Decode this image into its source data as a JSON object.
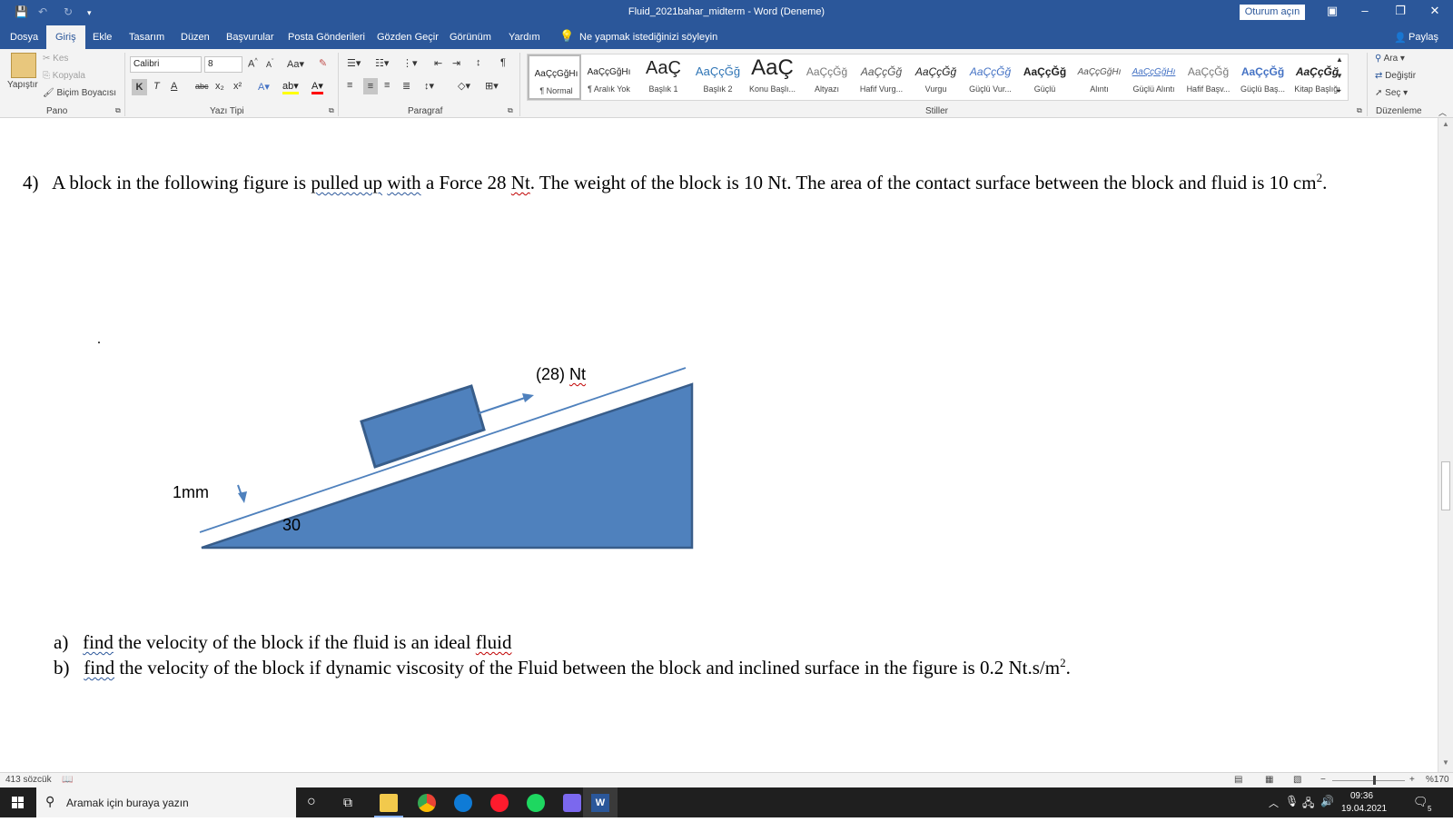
{
  "window": {
    "title": "Fluid_2021bahar_midterm  -  Word (Deneme)",
    "signin_label": "Oturum açın"
  },
  "tabs": [
    "Dosya",
    "Giriş",
    "Ekle",
    "Tasarım",
    "Düzen",
    "Başvurular",
    "Posta Gönderileri",
    "Gözden Geçir",
    "Görünüm",
    "Yardım"
  ],
  "active_tab": "Giriş",
  "tell_me": "Ne yapmak istediğinizi söyleyin",
  "share_label": "Paylaş",
  "ribbon": {
    "clipboard": {
      "paste": "Yapıştır",
      "cut": "Kes",
      "copy": "Kopyala",
      "format_painter": "Biçim Boyacısı",
      "label": "Pano"
    },
    "font": {
      "name": "Calibri",
      "size": "8",
      "bold": "K",
      "italic": "T",
      "underline": "A",
      "strike": "abc",
      "subscript": "x₂",
      "superscript": "x²",
      "label": "Yazı Tipi"
    },
    "paragraph": {
      "label": "Paragraf"
    },
    "styles": {
      "label": "Stiller",
      "items": [
        {
          "preview": "AaÇçĞğHı",
          "name": "¶ Normal"
        },
        {
          "preview": "AaÇçĞğHı",
          "name": "¶ Aralık Yok"
        },
        {
          "preview": "AaÇ",
          "name": "Başlık 1"
        },
        {
          "preview": "AaÇçĞğ",
          "name": "Başlık 2"
        },
        {
          "preview": "AaÇ",
          "name": "Konu Başlı..."
        },
        {
          "preview": "AaÇçĞğ",
          "name": "Altyazı"
        },
        {
          "preview": "AaÇçĞğ",
          "name": "Hafif Vurg..."
        },
        {
          "preview": "AaÇçĞğ",
          "name": "Vurgu"
        },
        {
          "preview": "AaÇçĞğ",
          "name": "Güçlü Vur..."
        },
        {
          "preview": "AaÇçĞğ",
          "name": "Güçlü"
        },
        {
          "preview": "AaÇçĞğHı",
          "name": "Alıntı"
        },
        {
          "preview": "AaÇçĞğHı",
          "name": "Güçlü Alıntı"
        },
        {
          "preview": "AaÇçĞğ",
          "name": "Hafif Başv..."
        },
        {
          "preview": "AaÇçĞğ",
          "name": "Güçlü Baş..."
        },
        {
          "preview": "AaÇçĞğ",
          "name": "Kitap Başlığı"
        }
      ]
    },
    "editing": {
      "find": "Ara",
      "replace": "Değiştir",
      "select": "Seç",
      "label": "Düzenleme"
    }
  },
  "document": {
    "question_number": "4)",
    "q_part1": "A block in the following figure is",
    "q_pulled": "pulled up",
    "q_with": "with",
    "q_part2": "a Force 28",
    "q_nt": "Nt",
    "q_part3": ". The weight of the block is 10 Nt. The area of the contact surface between the block and fluid is 10 cm",
    "q_sup": "2",
    "q_end": ".",
    "dot": ".",
    "figure": {
      "force_value": "(28)",
      "force_unit": "Nt",
      "gap_label": "1mm",
      "angle_label": "30"
    },
    "a_marker": "a)",
    "a_find": "find",
    "a_text": "the velocity of the block if the fluid is an ideal",
    "a_fluid": "fluid",
    "b_marker": "b)",
    "b_find": "find",
    "b_text": "the velocity of the block if dynamic viscosity of the Fluid between the block and inclined surface in the figure is 0.2 Nt.s/m",
    "b_sup": "2",
    "b_end": "."
  },
  "status": {
    "word_count": "413 sözcük",
    "zoom": "%170"
  },
  "taskbar": {
    "search_placeholder": "Aramak için buraya yazın",
    "time": "09:36",
    "date": "19.04.2021",
    "notifications": "5"
  },
  "colors": {
    "accent": "#2b579a",
    "figure_fill": "#4f81bd",
    "figure_stroke": "#385d8a",
    "squiggle": "#c00000"
  }
}
